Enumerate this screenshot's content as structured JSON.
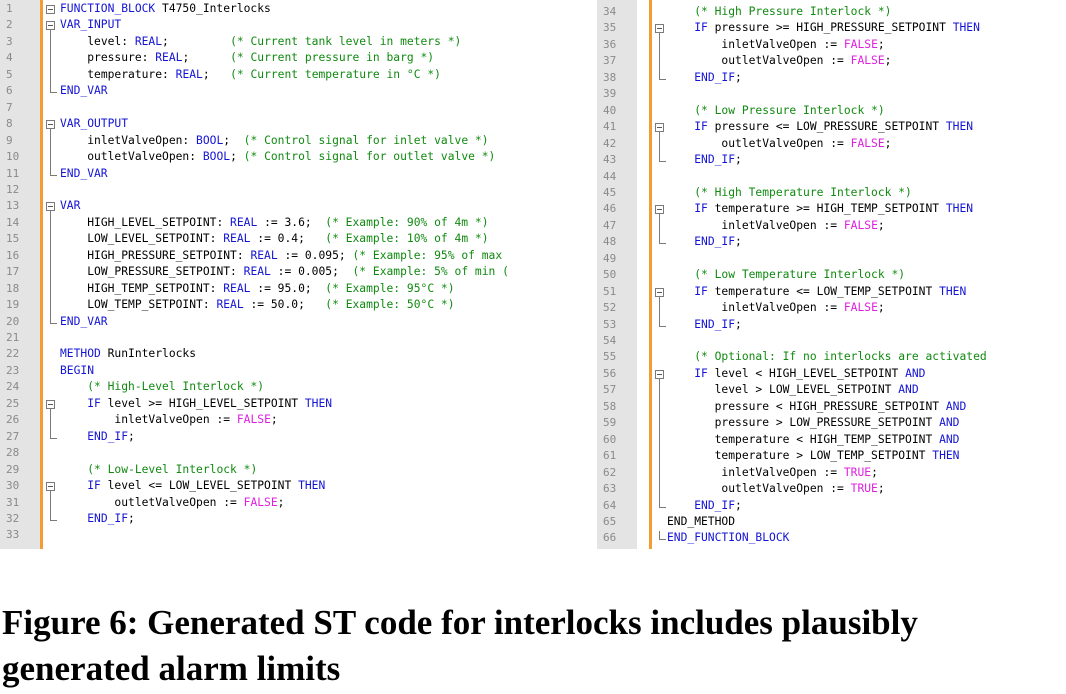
{
  "left_panel": {
    "lines": [
      {
        "n": "1",
        "fold": "start",
        "indent": 0,
        "tokens": [
          [
            "kw",
            "FUNCTION_BLOCK"
          ],
          [
            "tx",
            " T4750_Interlocks"
          ]
        ]
      },
      {
        "n": "2",
        "fold": "start",
        "indent": 0,
        "tokens": [
          [
            "kw",
            "VAR_INPUT"
          ]
        ]
      },
      {
        "n": "3",
        "fold": "",
        "indent": 4,
        "tokens": [
          [
            "tx",
            "level: "
          ],
          [
            "kw",
            "REAL"
          ],
          [
            "tx",
            ";         "
          ],
          [
            "cm",
            "(* Current tank level in meters *)"
          ]
        ]
      },
      {
        "n": "4",
        "fold": "",
        "indent": 4,
        "tokens": [
          [
            "tx",
            "pressure: "
          ],
          [
            "kw",
            "REAL"
          ],
          [
            "tx",
            ";      "
          ],
          [
            "cm",
            "(* Current pressure in barg *)"
          ]
        ]
      },
      {
        "n": "5",
        "fold": "",
        "indent": 4,
        "tokens": [
          [
            "tx",
            "temperature: "
          ],
          [
            "kw",
            "REAL"
          ],
          [
            "tx",
            ";   "
          ],
          [
            "cm",
            "(* Current temperature in °C *)"
          ]
        ]
      },
      {
        "n": "6",
        "fold": "end",
        "indent": 0,
        "tokens": [
          [
            "kw",
            "END_VAR"
          ]
        ]
      },
      {
        "n": "7",
        "fold": "",
        "indent": 0,
        "tokens": []
      },
      {
        "n": "8",
        "fold": "start",
        "indent": 0,
        "tokens": [
          [
            "kw",
            "VAR_OUTPUT"
          ]
        ]
      },
      {
        "n": "9",
        "fold": "",
        "indent": 4,
        "tokens": [
          [
            "tx",
            "inletValveOpen: "
          ],
          [
            "kw",
            "BOOL"
          ],
          [
            "tx",
            ";  "
          ],
          [
            "cm",
            "(* Control signal for inlet valve *)"
          ]
        ]
      },
      {
        "n": "10",
        "fold": "",
        "indent": 4,
        "tokens": [
          [
            "tx",
            "outletValveOpen: "
          ],
          [
            "kw",
            "BOOL"
          ],
          [
            "tx",
            "; "
          ],
          [
            "cm",
            "(* Control signal for outlet valve *)"
          ]
        ]
      },
      {
        "n": "11",
        "fold": "end",
        "indent": 0,
        "tokens": [
          [
            "kw",
            "END_VAR"
          ]
        ]
      },
      {
        "n": "12",
        "fold": "",
        "indent": 0,
        "tokens": []
      },
      {
        "n": "13",
        "fold": "start",
        "indent": 0,
        "tokens": [
          [
            "kw",
            "VAR"
          ]
        ]
      },
      {
        "n": "14",
        "fold": "",
        "indent": 4,
        "tokens": [
          [
            "tx",
            "HIGH_LEVEL_SETPOINT: "
          ],
          [
            "kw",
            "REAL"
          ],
          [
            "tx",
            " := 3.6;  "
          ],
          [
            "cm",
            "(* Example: 90% of 4m *)"
          ]
        ]
      },
      {
        "n": "15",
        "fold": "",
        "indent": 4,
        "tokens": [
          [
            "tx",
            "LOW_LEVEL_SETPOINT: "
          ],
          [
            "kw",
            "REAL"
          ],
          [
            "tx",
            " := 0.4;   "
          ],
          [
            "cm",
            "(* Example: 10% of 4m *)"
          ]
        ]
      },
      {
        "n": "16",
        "fold": "",
        "indent": 4,
        "tokens": [
          [
            "tx",
            "HIGH_PRESSURE_SETPOINT: "
          ],
          [
            "kw",
            "REAL"
          ],
          [
            "tx",
            " := 0.095; "
          ],
          [
            "cm",
            "(* Example: 95% of max"
          ]
        ]
      },
      {
        "n": "17",
        "fold": "",
        "indent": 4,
        "tokens": [
          [
            "tx",
            "LOW_PRESSURE_SETPOINT: "
          ],
          [
            "kw",
            "REAL"
          ],
          [
            "tx",
            " := 0.005;  "
          ],
          [
            "cm",
            "(* Example: 5% of min ("
          ]
        ]
      },
      {
        "n": "18",
        "fold": "",
        "indent": 4,
        "tokens": [
          [
            "tx",
            "HIGH_TEMP_SETPOINT: "
          ],
          [
            "kw",
            "REAL"
          ],
          [
            "tx",
            " := 95.0;  "
          ],
          [
            "cm",
            "(* Example: 95°C *)"
          ]
        ]
      },
      {
        "n": "19",
        "fold": "",
        "indent": 4,
        "tokens": [
          [
            "tx",
            "LOW_TEMP_SETPOINT: "
          ],
          [
            "kw",
            "REAL"
          ],
          [
            "tx",
            " := 50.0;   "
          ],
          [
            "cm",
            "(* Example: 50°C *)"
          ]
        ]
      },
      {
        "n": "20",
        "fold": "end",
        "indent": 0,
        "tokens": [
          [
            "kw",
            "END_VAR"
          ]
        ]
      },
      {
        "n": "21",
        "fold": "",
        "indent": 0,
        "tokens": []
      },
      {
        "n": "22",
        "fold": "",
        "indent": 0,
        "tokens": [
          [
            "kw",
            "METHOD"
          ],
          [
            "tx",
            " RunInterlocks"
          ]
        ]
      },
      {
        "n": "23",
        "fold": "",
        "indent": 0,
        "tokens": [
          [
            "kw",
            "BEGIN"
          ]
        ]
      },
      {
        "n": "24",
        "fold": "",
        "indent": 4,
        "tokens": [
          [
            "cm",
            "(* High-Level Interlock *)"
          ]
        ]
      },
      {
        "n": "25",
        "fold": "start",
        "indent": 4,
        "tokens": [
          [
            "kw",
            "IF"
          ],
          [
            "tx",
            " level >= HIGH_LEVEL_SETPOINT "
          ],
          [
            "kw",
            "THEN"
          ]
        ]
      },
      {
        "n": "26",
        "fold": "",
        "indent": 8,
        "tokens": [
          [
            "tx",
            "inletValveOpen := "
          ],
          [
            "lit",
            "FALSE"
          ],
          [
            "tx",
            ";"
          ]
        ]
      },
      {
        "n": "27",
        "fold": "end",
        "indent": 4,
        "tokens": [
          [
            "kw",
            "END_IF"
          ],
          [
            "tx",
            ";"
          ]
        ]
      },
      {
        "n": "28",
        "fold": "",
        "indent": 0,
        "tokens": []
      },
      {
        "n": "29",
        "fold": "",
        "indent": 4,
        "tokens": [
          [
            "cm",
            "(* Low-Level Interlock *)"
          ]
        ]
      },
      {
        "n": "30",
        "fold": "start",
        "indent": 4,
        "tokens": [
          [
            "kw",
            "IF"
          ],
          [
            "tx",
            " level <= LOW_LEVEL_SETPOINT "
          ],
          [
            "kw",
            "THEN"
          ]
        ]
      },
      {
        "n": "31",
        "fold": "",
        "indent": 8,
        "tokens": [
          [
            "tx",
            "outletValveOpen := "
          ],
          [
            "lit",
            "FALSE"
          ],
          [
            "tx",
            ";"
          ]
        ]
      },
      {
        "n": "32",
        "fold": "end",
        "indent": 4,
        "tokens": [
          [
            "kw",
            "END_IF"
          ],
          [
            "tx",
            ";"
          ]
        ]
      },
      {
        "n": "33",
        "fold": "",
        "indent": 0,
        "tokens": []
      }
    ]
  },
  "right_panel": {
    "lines": [
      {
        "n": "34",
        "fold": "",
        "indent": 4,
        "tokens": [
          [
            "cm",
            "(* High Pressure Interlock *)"
          ]
        ]
      },
      {
        "n": "35",
        "fold": "start",
        "indent": 4,
        "tokens": [
          [
            "kw",
            "IF"
          ],
          [
            "tx",
            " pressure >= HIGH_PRESSURE_SETPOINT "
          ],
          [
            "kw",
            "THEN"
          ]
        ]
      },
      {
        "n": "36",
        "fold": "",
        "indent": 8,
        "tokens": [
          [
            "tx",
            "inletValveOpen := "
          ],
          [
            "lit",
            "FALSE"
          ],
          [
            "tx",
            ";"
          ]
        ]
      },
      {
        "n": "37",
        "fold": "",
        "indent": 8,
        "tokens": [
          [
            "tx",
            "outletValveOpen := "
          ],
          [
            "lit",
            "FALSE"
          ],
          [
            "tx",
            ";"
          ]
        ]
      },
      {
        "n": "38",
        "fold": "end",
        "indent": 4,
        "tokens": [
          [
            "kw",
            "END_IF"
          ],
          [
            "tx",
            ";"
          ]
        ]
      },
      {
        "n": "39",
        "fold": "",
        "indent": 0,
        "tokens": []
      },
      {
        "n": "40",
        "fold": "",
        "indent": 4,
        "tokens": [
          [
            "cm",
            "(* Low Pressure Interlock *)"
          ]
        ]
      },
      {
        "n": "41",
        "fold": "start",
        "indent": 4,
        "tokens": [
          [
            "kw",
            "IF"
          ],
          [
            "tx",
            " pressure <= LOW_PRESSURE_SETPOINT "
          ],
          [
            "kw",
            "THEN"
          ]
        ]
      },
      {
        "n": "42",
        "fold": "",
        "indent": 8,
        "tokens": [
          [
            "tx",
            "outletValveOpen := "
          ],
          [
            "lit",
            "FALSE"
          ],
          [
            "tx",
            ";"
          ]
        ]
      },
      {
        "n": "43",
        "fold": "end",
        "indent": 4,
        "tokens": [
          [
            "kw",
            "END_IF"
          ],
          [
            "tx",
            ";"
          ]
        ]
      },
      {
        "n": "44",
        "fold": "",
        "indent": 0,
        "tokens": []
      },
      {
        "n": "45",
        "fold": "",
        "indent": 4,
        "tokens": [
          [
            "cm",
            "(* High Temperature Interlock *)"
          ]
        ]
      },
      {
        "n": "46",
        "fold": "start",
        "indent": 4,
        "tokens": [
          [
            "kw",
            "IF"
          ],
          [
            "tx",
            " temperature >= HIGH_TEMP_SETPOINT "
          ],
          [
            "kw",
            "THEN"
          ]
        ]
      },
      {
        "n": "47",
        "fold": "",
        "indent": 8,
        "tokens": [
          [
            "tx",
            "inletValveOpen := "
          ],
          [
            "lit",
            "FALSE"
          ],
          [
            "tx",
            ";"
          ]
        ]
      },
      {
        "n": "48",
        "fold": "end",
        "indent": 4,
        "tokens": [
          [
            "kw",
            "END_IF"
          ],
          [
            "tx",
            ";"
          ]
        ]
      },
      {
        "n": "49",
        "fold": "",
        "indent": 0,
        "tokens": []
      },
      {
        "n": "50",
        "fold": "",
        "indent": 4,
        "tokens": [
          [
            "cm",
            "(* Low Temperature Interlock *)"
          ]
        ]
      },
      {
        "n": "51",
        "fold": "start",
        "indent": 4,
        "tokens": [
          [
            "kw",
            "IF"
          ],
          [
            "tx",
            " temperature <= LOW_TEMP_SETPOINT "
          ],
          [
            "kw",
            "THEN"
          ]
        ]
      },
      {
        "n": "52",
        "fold": "",
        "indent": 8,
        "tokens": [
          [
            "tx",
            "inletValveOpen := "
          ],
          [
            "lit",
            "FALSE"
          ],
          [
            "tx",
            ";"
          ]
        ]
      },
      {
        "n": "53",
        "fold": "end",
        "indent": 4,
        "tokens": [
          [
            "kw",
            "END_IF"
          ],
          [
            "tx",
            ";"
          ]
        ]
      },
      {
        "n": "54",
        "fold": "",
        "indent": 0,
        "tokens": []
      },
      {
        "n": "55",
        "fold": "",
        "indent": 4,
        "tokens": [
          [
            "cm",
            "(* Optional: If no interlocks are activated"
          ]
        ]
      },
      {
        "n": "56",
        "fold": "start",
        "indent": 4,
        "tokens": [
          [
            "kw",
            "IF"
          ],
          [
            "tx",
            " level < HIGH_LEVEL_SETPOINT "
          ],
          [
            "kw",
            "AND"
          ]
        ]
      },
      {
        "n": "57",
        "fold": "",
        "indent": 7,
        "tokens": [
          [
            "tx",
            "level > LOW_LEVEL_SETPOINT "
          ],
          [
            "kw",
            "AND"
          ]
        ]
      },
      {
        "n": "58",
        "fold": "",
        "indent": 7,
        "tokens": [
          [
            "tx",
            "pressure < HIGH_PRESSURE_SETPOINT "
          ],
          [
            "kw",
            "AND"
          ]
        ]
      },
      {
        "n": "59",
        "fold": "",
        "indent": 7,
        "tokens": [
          [
            "tx",
            "pressure > LOW_PRESSURE_SETPOINT "
          ],
          [
            "kw",
            "AND"
          ]
        ]
      },
      {
        "n": "60",
        "fold": "",
        "indent": 7,
        "tokens": [
          [
            "tx",
            "temperature < HIGH_TEMP_SETPOINT "
          ],
          [
            "kw",
            "AND"
          ]
        ]
      },
      {
        "n": "61",
        "fold": "",
        "indent": 7,
        "tokens": [
          [
            "tx",
            "temperature > LOW_TEMP_SETPOINT "
          ],
          [
            "kw",
            "THEN"
          ]
        ]
      },
      {
        "n": "62",
        "fold": "",
        "indent": 8,
        "tokens": [
          [
            "tx",
            "inletValveOpen := "
          ],
          [
            "lit",
            "TRUE"
          ],
          [
            "tx",
            ";"
          ]
        ]
      },
      {
        "n": "63",
        "fold": "",
        "indent": 8,
        "tokens": [
          [
            "tx",
            "outletValveOpen := "
          ],
          [
            "lit",
            "TRUE"
          ],
          [
            "tx",
            ";"
          ]
        ]
      },
      {
        "n": "64",
        "fold": "end",
        "indent": 4,
        "tokens": [
          [
            "kw",
            "END_IF"
          ],
          [
            "tx",
            ";"
          ]
        ]
      },
      {
        "n": "65",
        "fold": "",
        "indent": 0,
        "tokens": [
          [
            "tx",
            "END_METHOD"
          ]
        ]
      },
      {
        "n": "66",
        "fold": "end",
        "indent": 0,
        "tokens": [
          [
            "kw",
            "END_FUNCTION_BLOCK"
          ]
        ]
      }
    ]
  },
  "caption": "Figure 6: Generated ST code for interlocks includes plausibly generated alarm limits",
  "colors": {
    "keyword": "#1414d6",
    "comment": "#108a10",
    "literal": "#e020e0",
    "text": "#000000",
    "line_number": "#8a8a8a",
    "gutter": "#e4e4e4",
    "change_bar": "#f39c34"
  }
}
